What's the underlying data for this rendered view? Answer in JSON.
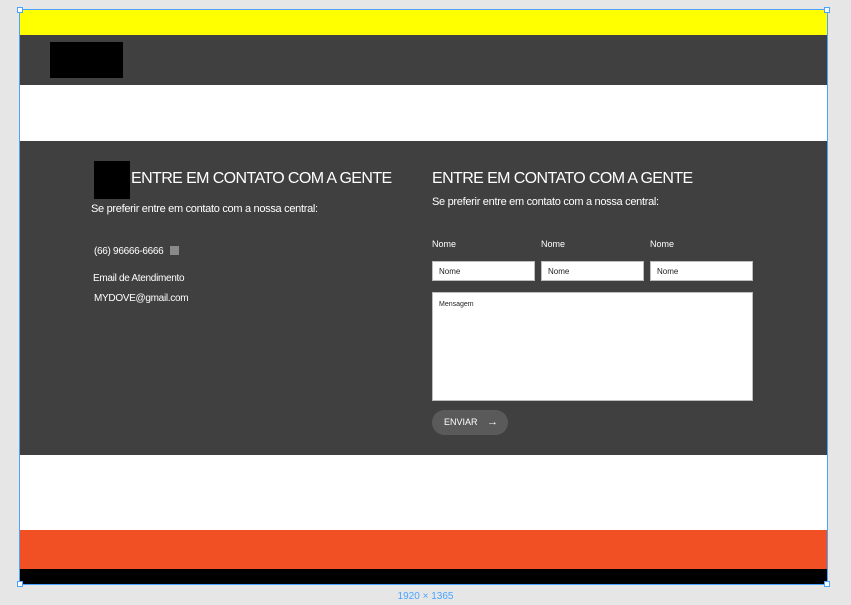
{
  "contact_left": {
    "title": "ENTRE EM CONTATO COM A GENTE",
    "subtitle": "Se preferir entre em contato com a nossa central:",
    "phone": "(66) 96666-6666",
    "email_label": "Email de Atendimento",
    "email": "MYDOVE@gmail.com"
  },
  "contact_form": {
    "title": "ENTRE EM CONTATO COM A GENTE",
    "subtitle": "Se preferir entre em contato com a nossa central:",
    "fields": [
      {
        "label": "Nome",
        "placeholder": "Nome"
      },
      {
        "label": "Nome",
        "placeholder": "Nome"
      },
      {
        "label": "Nome",
        "placeholder": "Nome"
      }
    ],
    "message_placeholder": "Mensagem",
    "submit_label": "ENVIAR"
  },
  "canvas": {
    "size_label": "1920 × 1365"
  },
  "colors": {
    "topbar": "#ffff00",
    "navbar": "#404040",
    "contact_bg": "#404040",
    "footer_orange": "#f05023",
    "selection": "#4aa3ff"
  },
  "icons": {
    "submit": "arrow-right-icon",
    "phone": "phone-icon"
  }
}
